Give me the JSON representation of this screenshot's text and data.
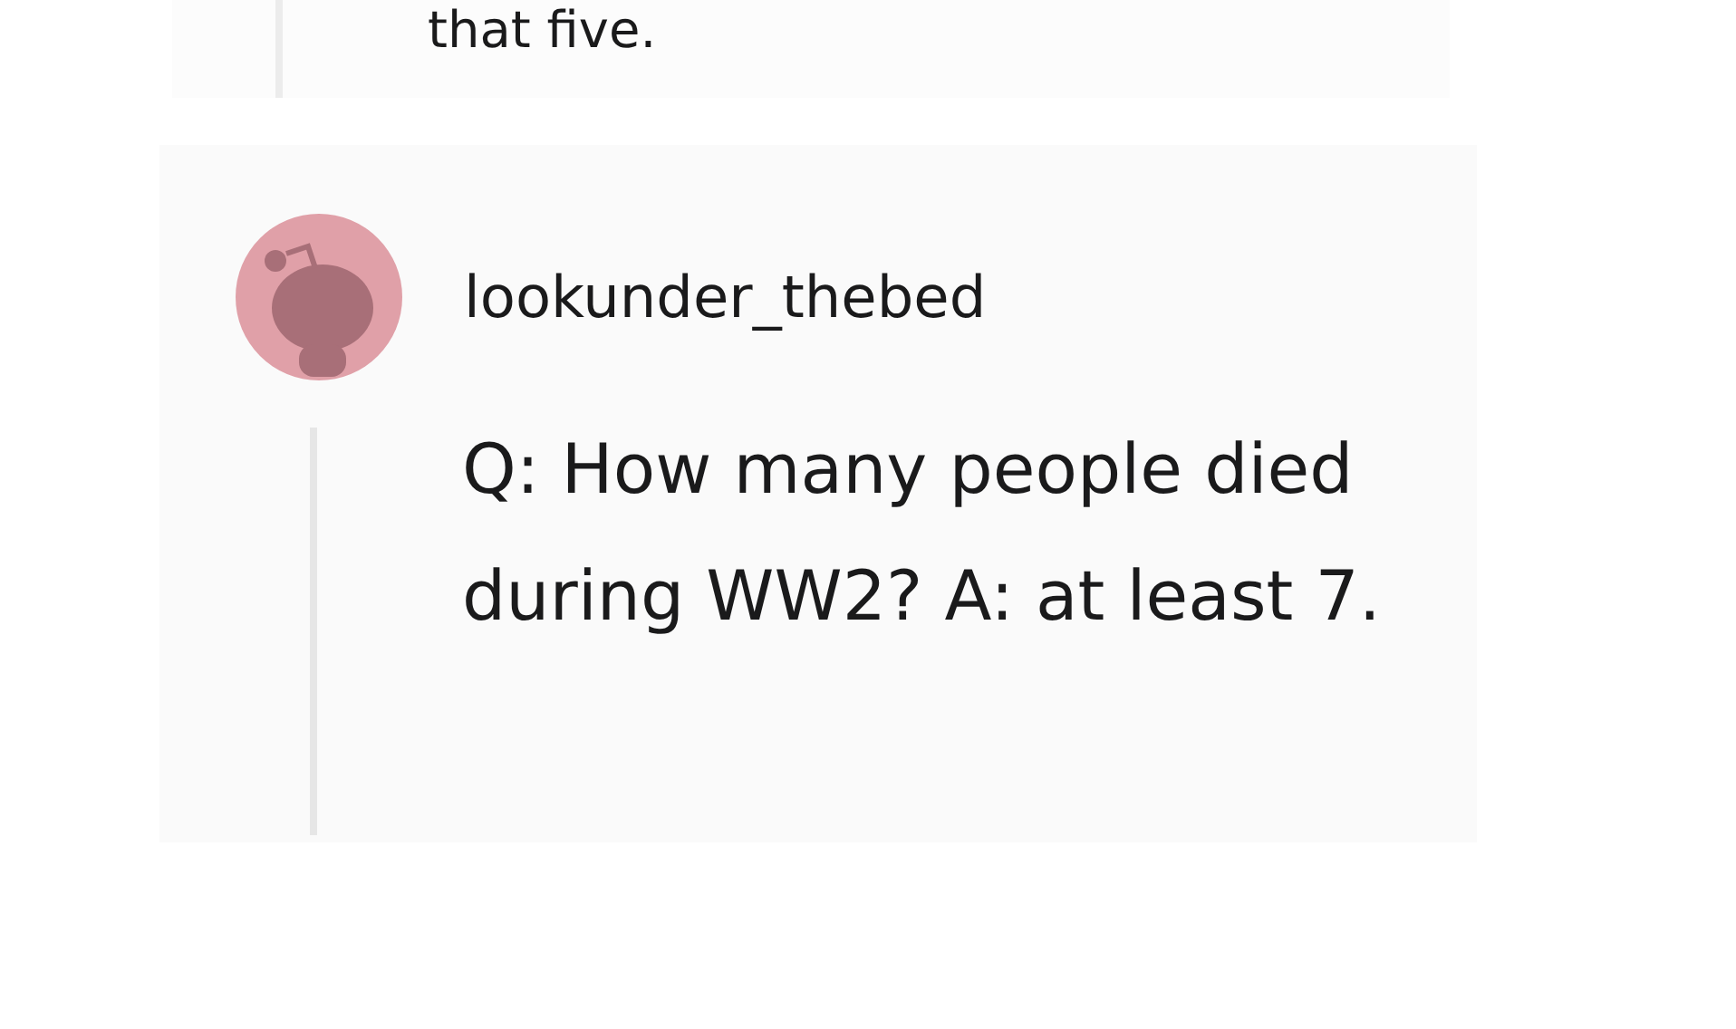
{
  "previous_comment": {
    "text": "that five."
  },
  "comment": {
    "username": "lookunder_thebed",
    "text": "Q: How many people died during WW2? A: at least 7."
  }
}
